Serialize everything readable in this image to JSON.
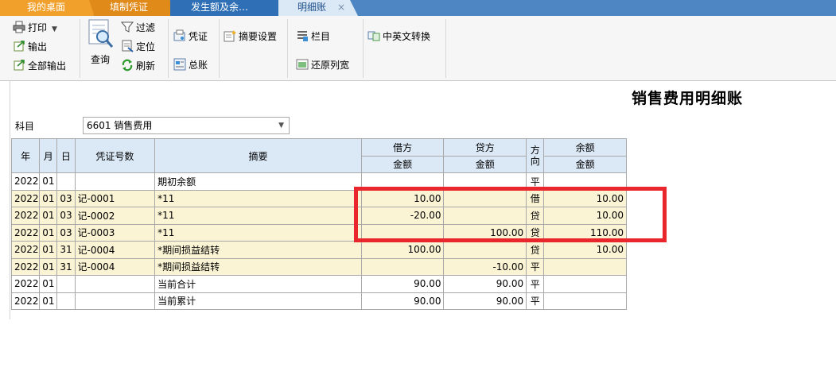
{
  "tabs": [
    {
      "label": "我的桌面"
    },
    {
      "label": "填制凭证"
    },
    {
      "label": "发生额及余…"
    },
    {
      "label": "明细账",
      "close": "×"
    }
  ],
  "toolbar": {
    "print": "打印",
    "export": "输出",
    "export_all": "全部输出",
    "query": "查询",
    "filter": "过滤",
    "locate": "定位",
    "refresh": "刷新",
    "voucher": "凭证",
    "general_ledger": "总账",
    "summary_settings": "摘要设置",
    "columns": "栏目",
    "restore_width": "还原列宽",
    "lang_switch": "中英文转换"
  },
  "page": {
    "title": "销售费用明细账",
    "subject_label": "科目",
    "subject_value": "6601 销售费用"
  },
  "table": {
    "headers": {
      "year": "年",
      "month": "月",
      "day": "日",
      "voucher_no": "凭证号数",
      "summary": "摘要",
      "debit": "借方",
      "credit": "贷方",
      "direction": "方向",
      "balance": "余额",
      "amount": "金额"
    },
    "rows": [
      {
        "year": "2022",
        "month": "01",
        "day": "",
        "voucher": "",
        "summary": "期初余额",
        "debit": "",
        "credit": "",
        "dir": "平",
        "balance": ""
      },
      {
        "year": "2022",
        "month": "01",
        "day": "03",
        "voucher": "记-0001",
        "summary": "*11",
        "debit": "10.00",
        "credit": "",
        "dir": "借",
        "balance": "10.00"
      },
      {
        "year": "2022",
        "month": "01",
        "day": "03",
        "voucher": "记-0002",
        "summary": "*11",
        "debit": "-20.00",
        "credit": "",
        "dir": "贷",
        "balance": "10.00"
      },
      {
        "year": "2022",
        "month": "01",
        "day": "03",
        "voucher": "记-0003",
        "summary": "*11",
        "debit": "",
        "credit": "100.00",
        "dir": "贷",
        "balance": "110.00"
      },
      {
        "year": "2022",
        "month": "01",
        "day": "31",
        "voucher": "记-0004",
        "summary": "*期间损益结转",
        "debit": "100.00",
        "credit": "",
        "dir": "贷",
        "balance": "10.00"
      },
      {
        "year": "2022",
        "month": "01",
        "day": "31",
        "voucher": "记-0004",
        "summary": "*期间损益结转",
        "debit": "",
        "credit": "-10.00",
        "dir": "平",
        "balance": ""
      },
      {
        "year": "2022",
        "month": "01",
        "day": "",
        "voucher": "",
        "summary": "当前合计",
        "debit": "90.00",
        "credit": "90.00",
        "dir": "平",
        "balance": ""
      },
      {
        "year": "2022",
        "month": "01",
        "day": "",
        "voucher": "",
        "summary": "当前累计",
        "debit": "90.00",
        "credit": "90.00",
        "dir": "平",
        "balance": ""
      }
    ]
  },
  "colors": {
    "tab_bar": "#4e86c4",
    "header_bg": "#dbe8f6",
    "voucher_row_bg": "#faf3d4",
    "highlight": "#e8262b"
  }
}
